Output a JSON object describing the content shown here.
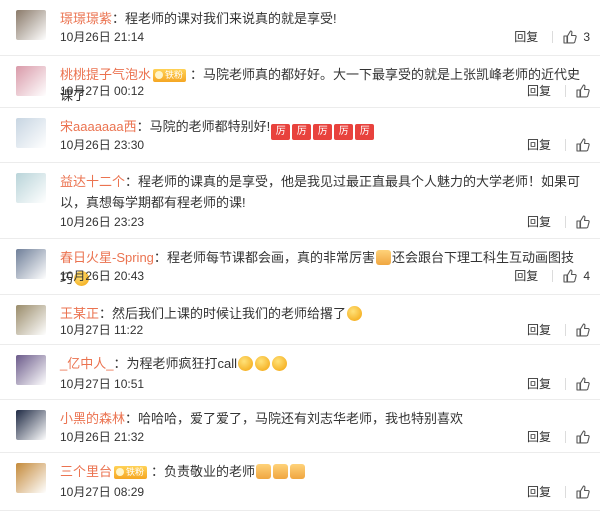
{
  "comments": [
    {
      "user": "璟璟璟紫",
      "badge": "",
      "parts": [
        {
          "t": "程老师的课对我们来说真的就是享受!"
        }
      ],
      "time": "10月26日 21:14",
      "reply": "回复",
      "likes": "3",
      "avatar_color": "#8a7a6a"
    },
    {
      "user": "桃桃提子气泡水",
      "badge": "铁粉",
      "parts": [
        {
          "t": "马院老师真的都好好。大一下最享受的就是上张凯峰老师的近代史课了"
        }
      ],
      "time": "10月27日 00:12",
      "reply": "回复",
      "likes": "",
      "avatar_color": "#d99aa9"
    },
    {
      "user": "宋aaaaaaa西",
      "badge": "",
      "parts": [
        {
          "t": "马院的老师都特别好!"
        },
        {
          "cheer": [
            "厉",
            "厉",
            "厉",
            "厉",
            "厉"
          ]
        }
      ],
      "time": "10月26日 23:30",
      "reply": "回复",
      "likes": "",
      "avatar_color": "#c7d5e2"
    },
    {
      "user": "益达十二个",
      "badge": "",
      "parts": [
        {
          "t": "程老师的课真的是享受，他是我见过最正直最具个人魅力的大学老师！如果可以，真想每学期都有程老师的课!"
        }
      ],
      "time": "10月26日 23:23",
      "reply": "回复",
      "likes": "",
      "avatar_color": "#b9d4d9"
    },
    {
      "user": "春日火星-Spring",
      "badge": "",
      "parts": [
        {
          "t": "程老师每节课都会画，真的非常厉害"
        },
        {
          "emoji": "thumb"
        },
        {
          "t": "还会跟台下理工科生互动画图技巧"
        },
        {
          "emoji": "face"
        }
      ],
      "time": "10月26日 20:43",
      "reply": "回复",
      "likes": "4",
      "avatar_color": "#6f7f99"
    },
    {
      "user": "王某正",
      "badge": "",
      "parts": [
        {
          "t": "然后我们上课的时候让我们的老师给撂了"
        },
        {
          "emoji": "face"
        }
      ],
      "time": "10月27日 11:22",
      "reply": "回复",
      "likes": "",
      "avatar_color": "#9a8c6a"
    },
    {
      "user": "_亿中人_",
      "badge": "",
      "parts": [
        {
          "t": "为程老师疯狂打call"
        },
        {
          "emoji": "face"
        },
        {
          "emoji": "face"
        },
        {
          "emoji": "face"
        }
      ],
      "time": "10月27日 10:51",
      "reply": "回复",
      "likes": "",
      "avatar_color": "#6b5a8a"
    },
    {
      "user": "小黑的森林",
      "badge": "",
      "parts": [
        {
          "t": "哈哈哈，爱了爱了，马院还有刘志华老师，我也特别喜欢"
        }
      ],
      "time": "10月26日 21:32",
      "reply": "回复",
      "likes": "",
      "avatar_color": "#1f2a44"
    },
    {
      "user": "三个里台",
      "badge": "铁粉",
      "parts": [
        {
          "t": "负责敬业的老师"
        },
        {
          "emoji": "thumb"
        },
        {
          "emoji": "thumb"
        },
        {
          "emoji": "thumb"
        }
      ],
      "time": "10月27日 08:29",
      "reply": "回复",
      "likes": "",
      "avatar_color": "#c48a3a"
    }
  ],
  "colon": "："
}
